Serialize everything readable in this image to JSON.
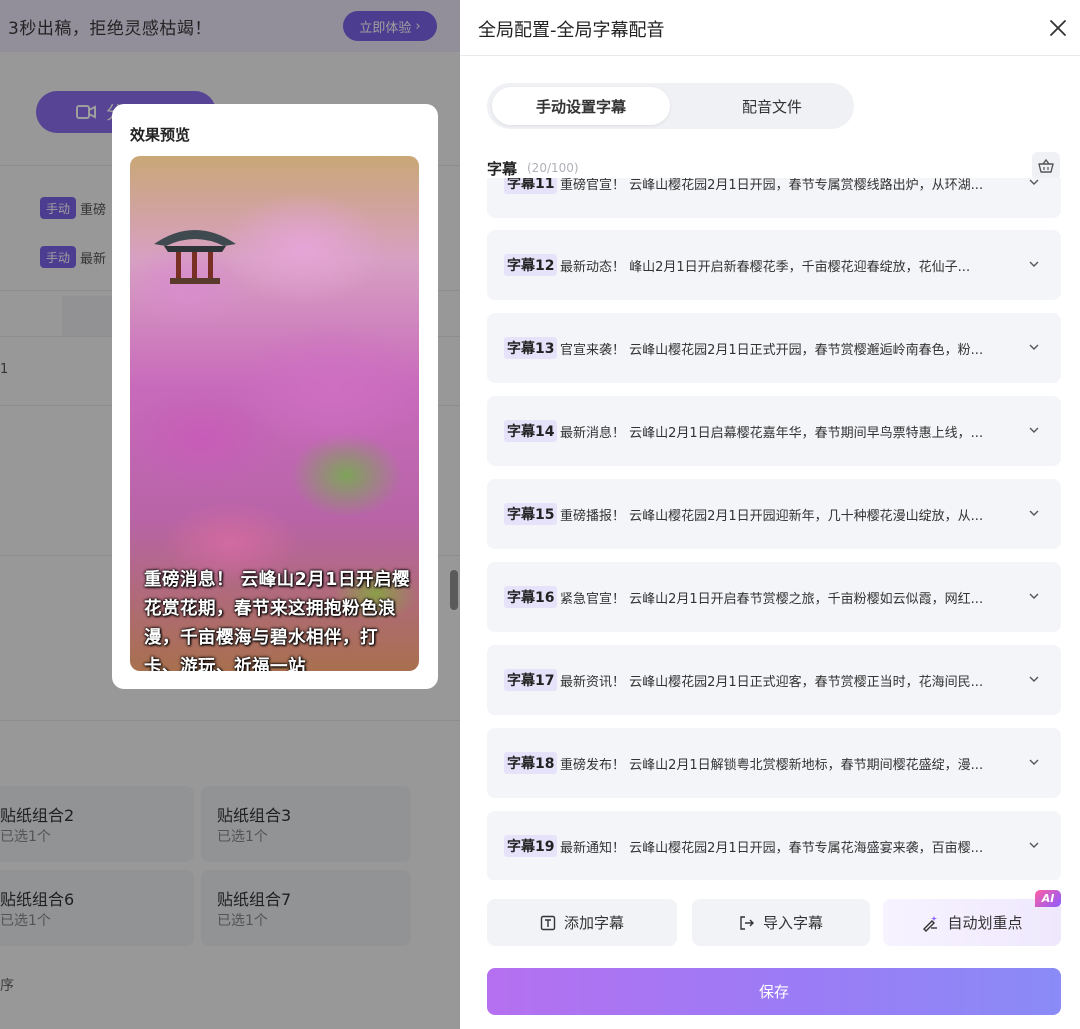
{
  "background": {
    "banner_text": "3秒出稿，拒绝灵感枯竭！",
    "banner_button": "立即体验",
    "big_button": "分",
    "rows": [
      {
        "tag": "手动",
        "text": "重磅"
      },
      {
        "tag": "手动",
        "text": "最新"
      }
    ],
    "row_number": "1",
    "cards": [
      {
        "title": "贴纸组合2",
        "sub": "已选1个"
      },
      {
        "title": "贴纸组合3",
        "sub": "已选1个"
      },
      {
        "title": "贴纸组合6",
        "sub": "已选1个"
      },
      {
        "title": "贴纸组合7",
        "sub": "已选1个"
      }
    ],
    "sort_label": "序"
  },
  "preview": {
    "title": "效果预览",
    "caption": "重磅消息！ 云峰山2月1日开启樱花赏花期，春节来这拥抱粉色浪漫，千亩樱海与碧水相伴，打卡、游玩、祈福一站"
  },
  "panel": {
    "title": "全局配置-全局字幕配音",
    "tabs": [
      {
        "label": "手动设置字幕",
        "active": true
      },
      {
        "label": "配音文件",
        "active": false
      }
    ],
    "subtitle_label": "字幕",
    "subtitle_count": "(20/100)",
    "items": [
      {
        "tag": "字幕11",
        "text": "重磅官宣！ 云峰山樱花园2月1日开园，春节专属赏樱线路出炉，从环湖..."
      },
      {
        "tag": "字幕12",
        "text": "最新动态！ 峰山2月1日开启新春樱花季，千亩樱花迎春绽放，花仙子..."
      },
      {
        "tag": "字幕13",
        "text": "官宣来袭！ 云峰山樱花园2月1日正式开园，春节赏樱邂逅岭南春色，粉..."
      },
      {
        "tag": "字幕14",
        "text": "最新消息！ 云峰山2月1日启幕樱花嘉年华，春节期间早鸟票特惠上线，..."
      },
      {
        "tag": "字幕15",
        "text": "重磅播报！ 云峰山樱花园2月1日开园迎新年，几十种樱花漫山绽放，从..."
      },
      {
        "tag": "字幕16",
        "text": "紧急官宣！ 云峰山2月1日开启春节赏樱之旅，千亩粉樱如云似霞，网红..."
      },
      {
        "tag": "字幕17",
        "text": "最新资讯！ 云峰山樱花园2月1日正式迎客，春节赏樱正当时，花海间民..."
      },
      {
        "tag": "字幕18",
        "text": "重磅发布！ 云峰山2月1日解锁粤北赏樱新地标，春节期间樱花盛绽，漫..."
      },
      {
        "tag": "字幕19",
        "text": "最新通知！ 云峰山樱花园2月1日开园，春节专属花海盛宴来袭，百亩樱..."
      }
    ],
    "actions": {
      "add": "添加字幕",
      "import": "导入字幕",
      "auto": "自动划重点",
      "ai_badge": "AI"
    },
    "save": "保存"
  }
}
